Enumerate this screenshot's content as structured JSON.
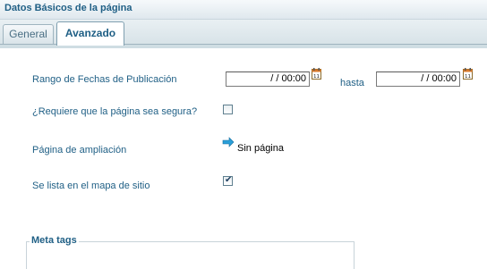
{
  "header": {
    "title": "Datos Básicos de la página"
  },
  "tabs": [
    {
      "label": "General",
      "active": false
    },
    {
      "label": "Avanzado",
      "active": true
    }
  ],
  "form": {
    "fecha_label": "Rango de Fechas de Publicación",
    "fecha_desde": " /  /  00:00",
    "hasta_label": "hasta",
    "fecha_hasta": " /  /  00:00",
    "segura_label": "¿Requiere que la página sea segura?",
    "segura_checked": false,
    "ampliacion_label": "Página de ampliación",
    "ampliacion_value": "Sin página",
    "mapa_label": "Se lista en el mapa de sitio",
    "mapa_checked": true
  },
  "meta": {
    "legend": "Meta tags"
  },
  "colors": {
    "accent": "#1f5f85",
    "tab_border": "#9fb4bf",
    "arrow": "#2a9fd8"
  },
  "icons": [
    "calendar-icon",
    "arrow-right-icon",
    "checkmark-icon"
  ]
}
